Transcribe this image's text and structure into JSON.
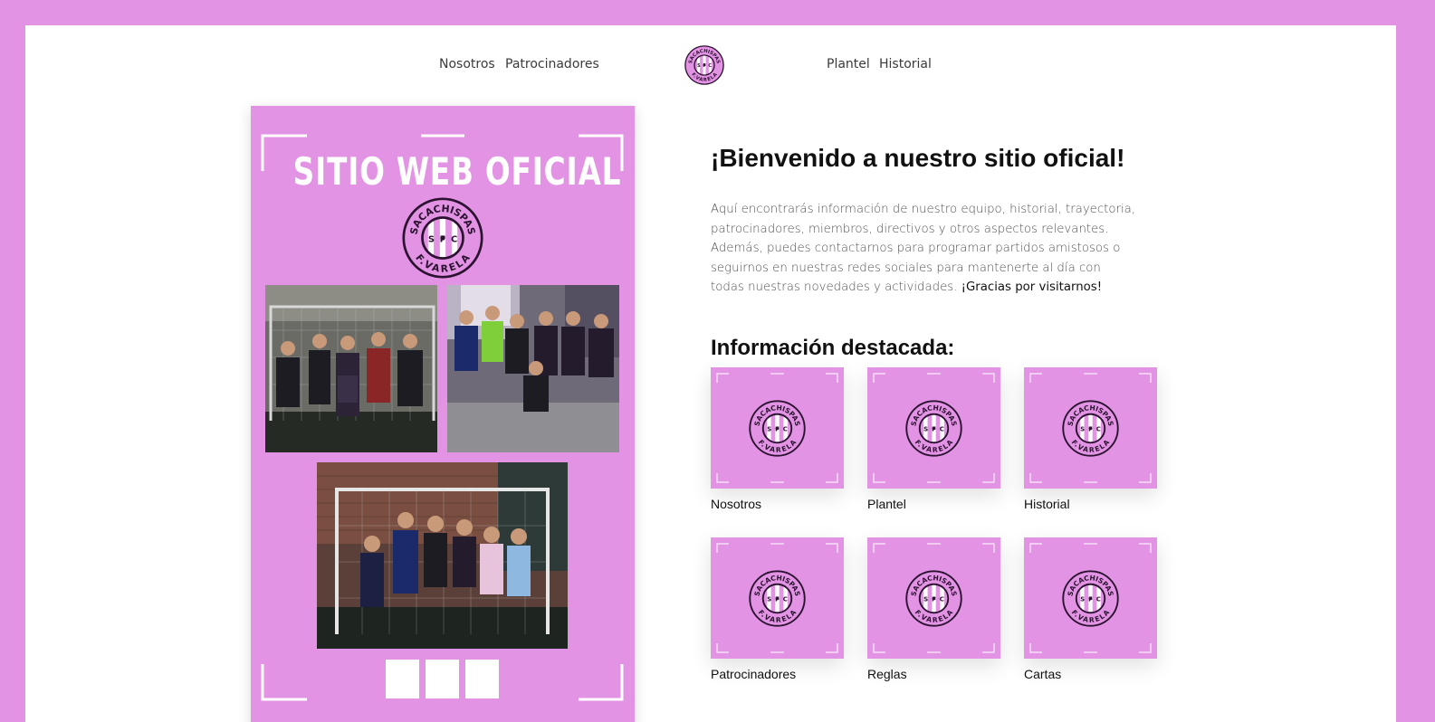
{
  "nav": {
    "left": [
      "Nosotros",
      "Patrocinadores"
    ],
    "right": [
      "Plantel",
      "Historial"
    ]
  },
  "logo": {
    "top_text": "SACACHISPAS",
    "letters": [
      "S",
      "F",
      "C"
    ],
    "bottom_text": "F.VARELA"
  },
  "hero": {
    "title": "SITIO WEB OFICIAL"
  },
  "main": {
    "welcome": "¡Bienvenido a nuestro sitio oficial!",
    "intro": "Aquí encontrarás información de nuestro equipo, historial, trayectoria, patrocinadores, miembros, directivos y otros aspectos relevantes. Además, puedes contactarnos para programar partidos amistosos o seguirnos en nuestras redes sociales para mantenerte al día con todas nuestras novedades y actividades.",
    "thanks": "¡Gracias por visitarnos!",
    "featured_heading": "Información destacada:",
    "cards": [
      "Nosotros",
      "Plantel",
      "Historial",
      "Patrocinadores",
      "Reglas",
      "Cartas"
    ]
  },
  "colors": {
    "brand": "#e293e3",
    "logo_dark": "#2a1230"
  }
}
